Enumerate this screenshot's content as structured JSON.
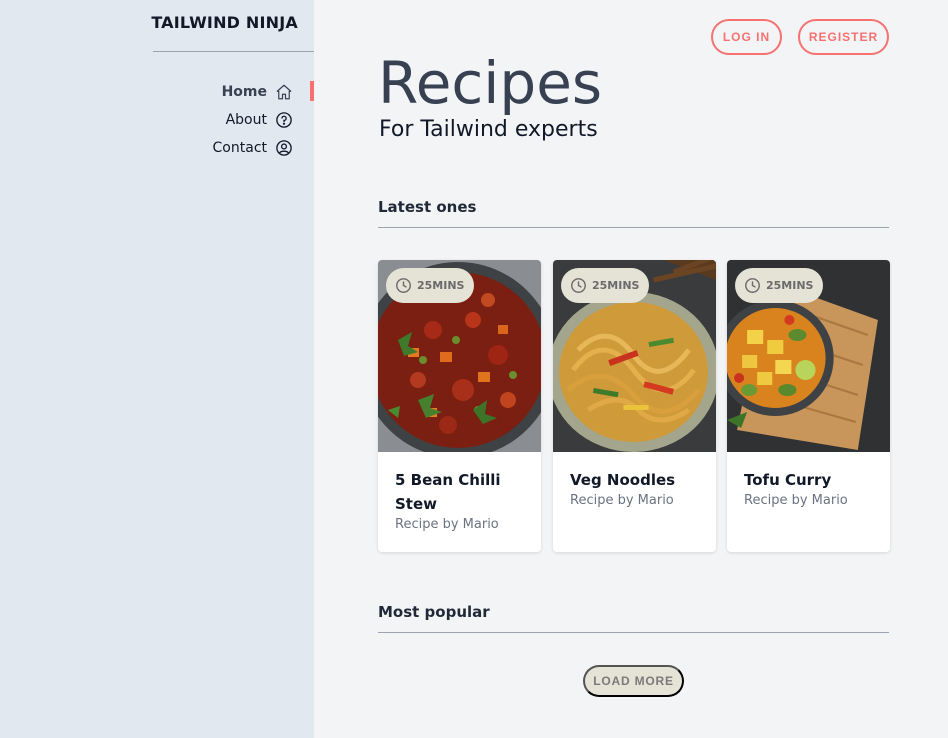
{
  "sidebar": {
    "brand": "TAILWIND NINJA",
    "items": [
      {
        "label": "Home",
        "icon": "home-icon",
        "active": true
      },
      {
        "label": "About",
        "icon": "help-circle-icon",
        "active": false
      },
      {
        "label": "Contact",
        "icon": "user-circle-icon",
        "active": false
      }
    ]
  },
  "header": {
    "login_label": "LOG IN",
    "register_label": "REGISTER"
  },
  "main": {
    "title": "Recipes",
    "subtitle": "For Tailwind experts",
    "latest_title": "Latest ones",
    "popular_title": "Most popular",
    "load_more_label": "LOAD MORE",
    "cards": [
      {
        "time": "25MINS",
        "title": "5 Bean Chilli Stew",
        "author": "Recipe by Mario",
        "image": "bean-chilli-stew-image"
      },
      {
        "time": "25MINS",
        "title": "Veg Noodles",
        "author": "Recipe by Mario",
        "image": "veg-noodles-image"
      },
      {
        "time": "25MINS",
        "title": "Tofu Curry",
        "author": "Recipe by Mario",
        "image": "tofu-curry-image"
      }
    ]
  },
  "colors": {
    "accent": "#f87171",
    "sidebar_bg": "#e2e8f0",
    "page_bg": "#f3f4f6",
    "badge_bg": "#e5e2d6"
  }
}
